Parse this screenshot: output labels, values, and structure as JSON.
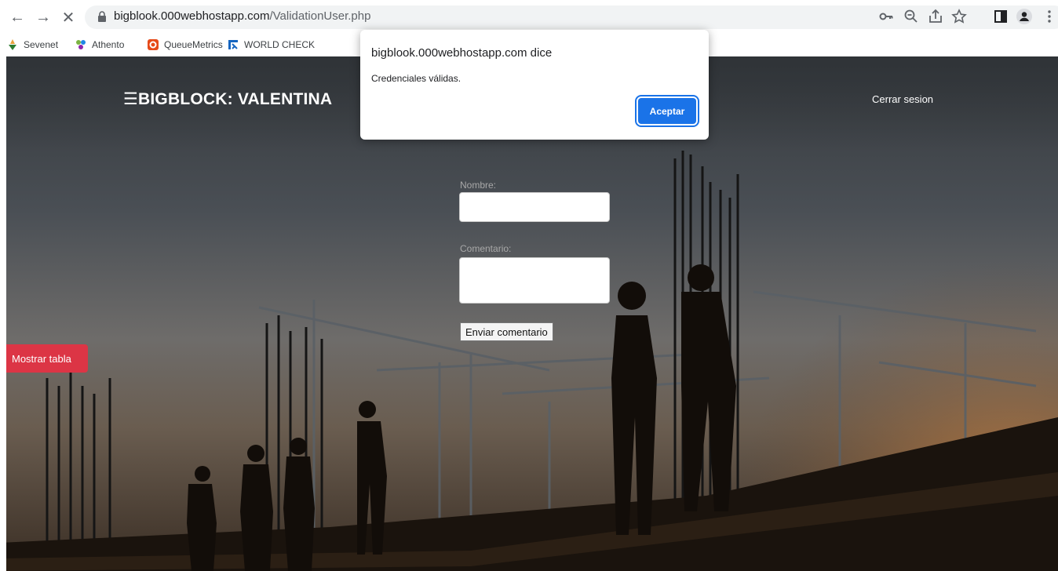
{
  "browser": {
    "url_host": "bigblook.000webhostapp.com",
    "url_path": "/ValidationUser.php",
    "nav": {
      "back_icon": "←",
      "forward_icon": "→",
      "stop_icon": "✕"
    },
    "right_icons": [
      "key-icon",
      "zoom-icon",
      "share-icon",
      "star-icon",
      "sidepanel-icon",
      "profile-icon",
      "menu-icon"
    ]
  },
  "bookmarks": [
    {
      "label": "Sevenet",
      "icon": "sevenet-icon"
    },
    {
      "label": "Athento",
      "icon": "athento-icon"
    },
    {
      "label": "QueueMetrics",
      "icon": "queuemetrics-icon"
    },
    {
      "label": "WORLD CHECK",
      "icon": "worldcheck-icon"
    }
  ],
  "page": {
    "brand": "☰BIGBLOCK: VALENTINA",
    "logout": "Cerrar sesion",
    "form": {
      "name_label": "Nombre:",
      "name_value": "",
      "comment_label": "Comentario:",
      "comment_value": "",
      "submit": "Enviar comentario"
    },
    "show_table": "Mostrar tabla"
  },
  "dialog": {
    "title": "bigblook.000webhostapp.com dice",
    "message": "Credenciales válidas.",
    "ok": "Aceptar"
  },
  "colors": {
    "danger": "#dc3545",
    "primary": "#1a73e8"
  }
}
